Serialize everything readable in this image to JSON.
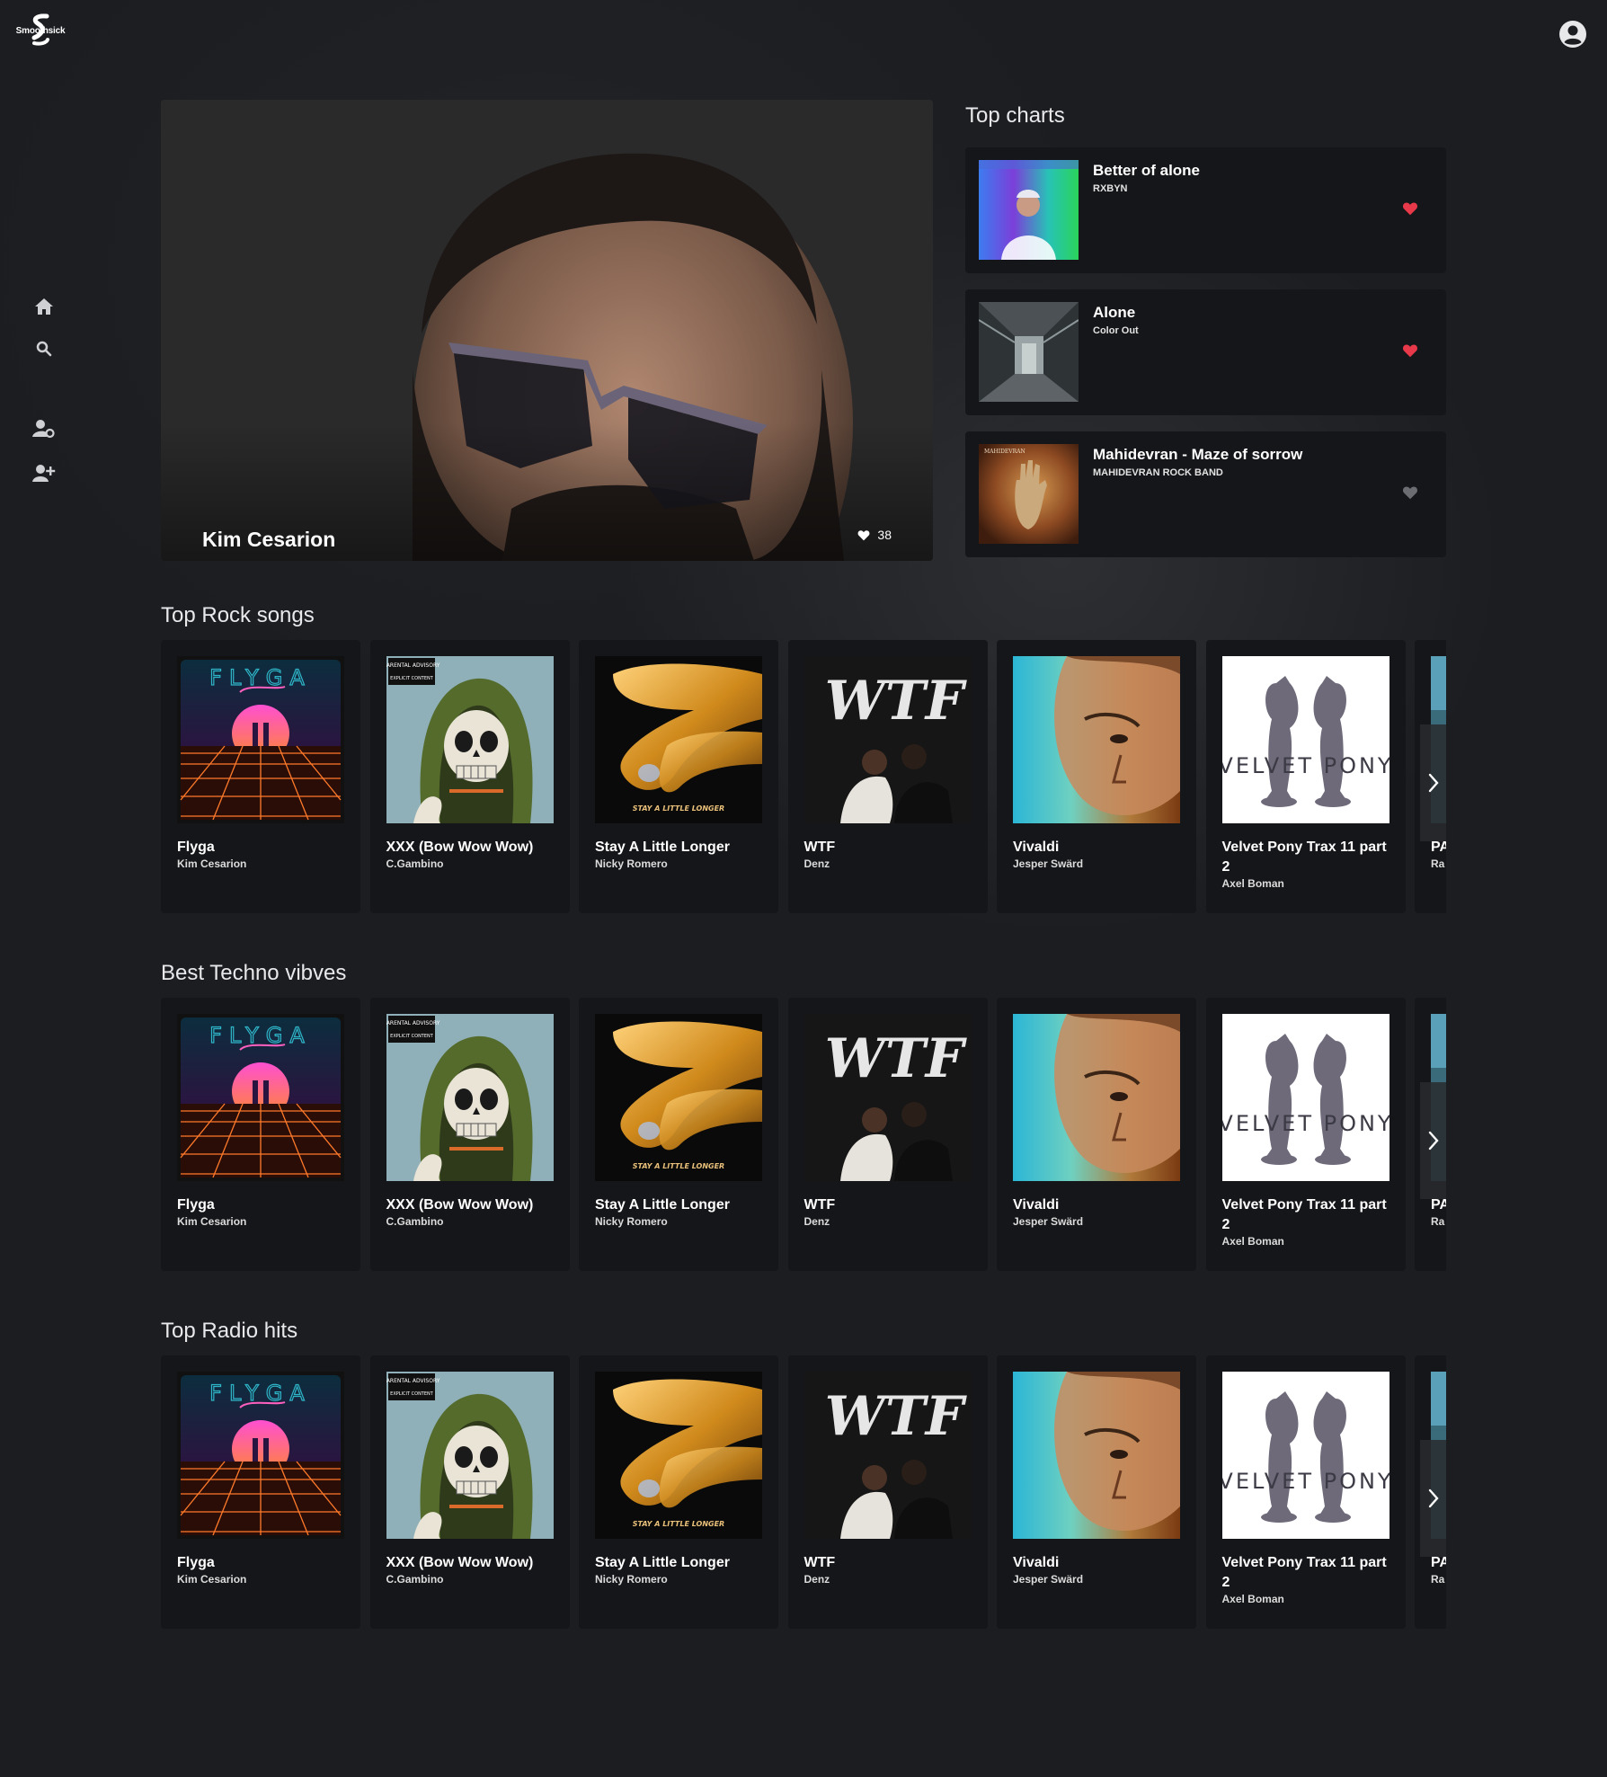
{
  "app": {
    "logo_text": "Smoothsick"
  },
  "nav": {
    "items": [
      {
        "icon": "home-icon"
      },
      {
        "icon": "search-icon"
      },
      {
        "icon": "account-settings-icon"
      },
      {
        "icon": "add-user-icon"
      }
    ]
  },
  "hero": {
    "artist": "Kim Cesarion",
    "likes": "38"
  },
  "top_charts": {
    "title": "Top charts",
    "items": [
      {
        "name": "Better of alone",
        "artist": "RXBYN",
        "liked": true,
        "heart_color": "#e8394a"
      },
      {
        "name": "Alone",
        "artist": "Color Out",
        "liked": true,
        "heart_color": "#e8394a"
      },
      {
        "name": "Mahidevran - Maze of sorrow",
        "artist": "MAHIDEVRAN ROCK BAND",
        "liked": false,
        "heart_color": "#6b6d72"
      }
    ]
  },
  "rows": [
    {
      "title": "Top Rock songs",
      "cards": [
        {
          "title": "Flyga",
          "artist": "Kim Cesarion"
        },
        {
          "title": "XXX (Bow Wow Wow)",
          "artist": "C.Gambino"
        },
        {
          "title": "Stay A Little Longer",
          "artist": "Nicky Romero"
        },
        {
          "title": "WTF",
          "artist": "Denz"
        },
        {
          "title": "Vivaldi",
          "artist": "Jesper Swärd"
        },
        {
          "title": "Velvet Pony Trax 11 part 2",
          "artist": "Axel Boman"
        },
        {
          "title": "PA",
          "artist": "Ra"
        }
      ]
    },
    {
      "title": "Best Techno vibves",
      "cards": [
        {
          "title": "Flyga",
          "artist": "Kim Cesarion"
        },
        {
          "title": "XXX (Bow Wow Wow)",
          "artist": "C.Gambino"
        },
        {
          "title": "Stay A Little Longer",
          "artist": "Nicky Romero"
        },
        {
          "title": "WTF",
          "artist": "Denz"
        },
        {
          "title": "Vivaldi",
          "artist": "Jesper Swärd"
        },
        {
          "title": "Velvet Pony Trax 11 part 2",
          "artist": "Axel Boman"
        },
        {
          "title": "PA",
          "artist": "Ra"
        }
      ]
    },
    {
      "title": "Top Radio hits",
      "cards": [
        {
          "title": "Flyga",
          "artist": "Kim Cesarion"
        },
        {
          "title": "XXX (Bow Wow Wow)",
          "artist": "C.Gambino"
        },
        {
          "title": "Stay A Little Longer",
          "artist": "Nicky Romero"
        },
        {
          "title": "WTF",
          "artist": "Denz"
        },
        {
          "title": "Vivaldi",
          "artist": "Jesper Swärd"
        },
        {
          "title": "Velvet Pony Trax 11 part 2",
          "artist": "Axel Boman"
        },
        {
          "title": "PA",
          "artist": "Ra"
        }
      ]
    }
  ],
  "cover_art_text": {
    "flyga": "FLYGA",
    "advisory": "PARENTAL ADVISORY",
    "advisory_sub": "EXPLICIT CONTENT",
    "stay": "STAY A LITTLE LONGER",
    "wtf": "WTF",
    "velvet": "VELVET PONY"
  }
}
